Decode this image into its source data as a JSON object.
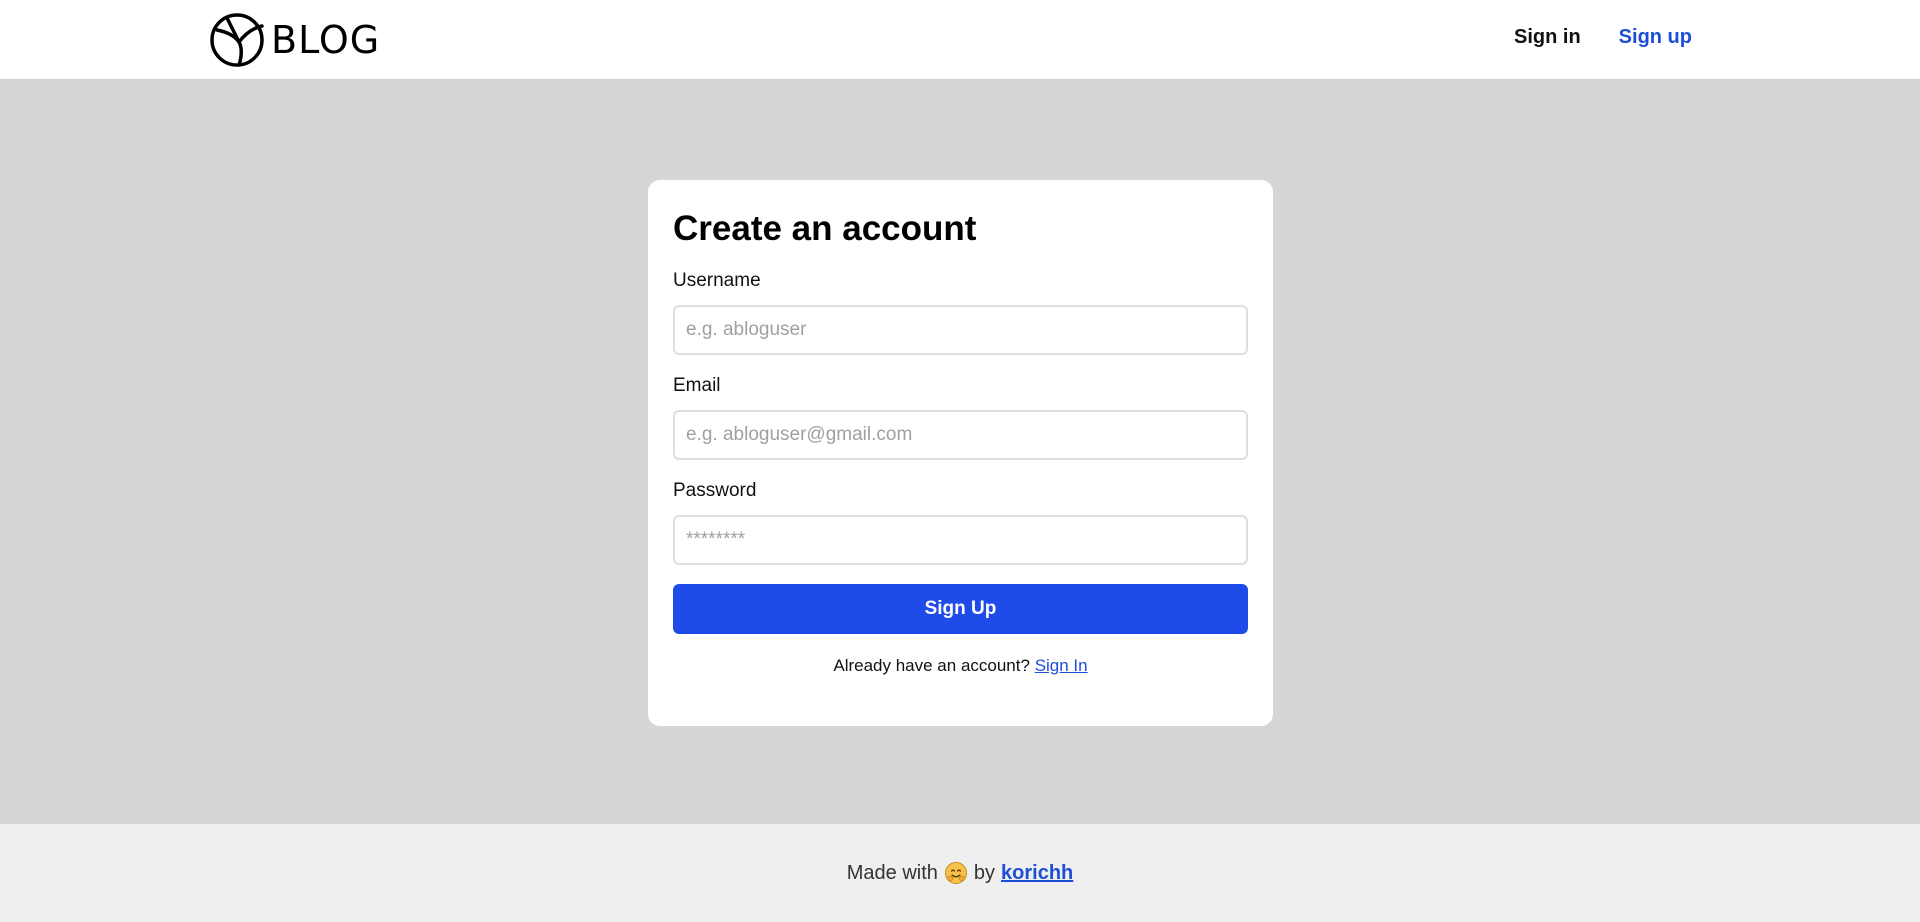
{
  "header": {
    "brand_text": "BLOG",
    "nav": {
      "signin_label": "Sign in",
      "signup_label": "Sign up"
    }
  },
  "form": {
    "title": "Create an account",
    "username": {
      "label": "Username",
      "placeholder": "e.g. abloguser",
      "value": ""
    },
    "email": {
      "label": "Email",
      "placeholder": "e.g. abloguser@gmail.com",
      "value": ""
    },
    "password": {
      "label": "Password",
      "placeholder": "********",
      "value": ""
    },
    "submit_label": "Sign Up",
    "already_text": "Already have an account?",
    "signin_link": "Sign In"
  },
  "footer": {
    "made_with": "Made with",
    "emoji_icon": "hugging-face-emoji",
    "by": "by",
    "author": "korichh"
  },
  "colors": {
    "accent": "#1f4ce8",
    "link": "#1d4ed8",
    "background": "#d6d6d6",
    "footer_bg": "#efefef"
  }
}
